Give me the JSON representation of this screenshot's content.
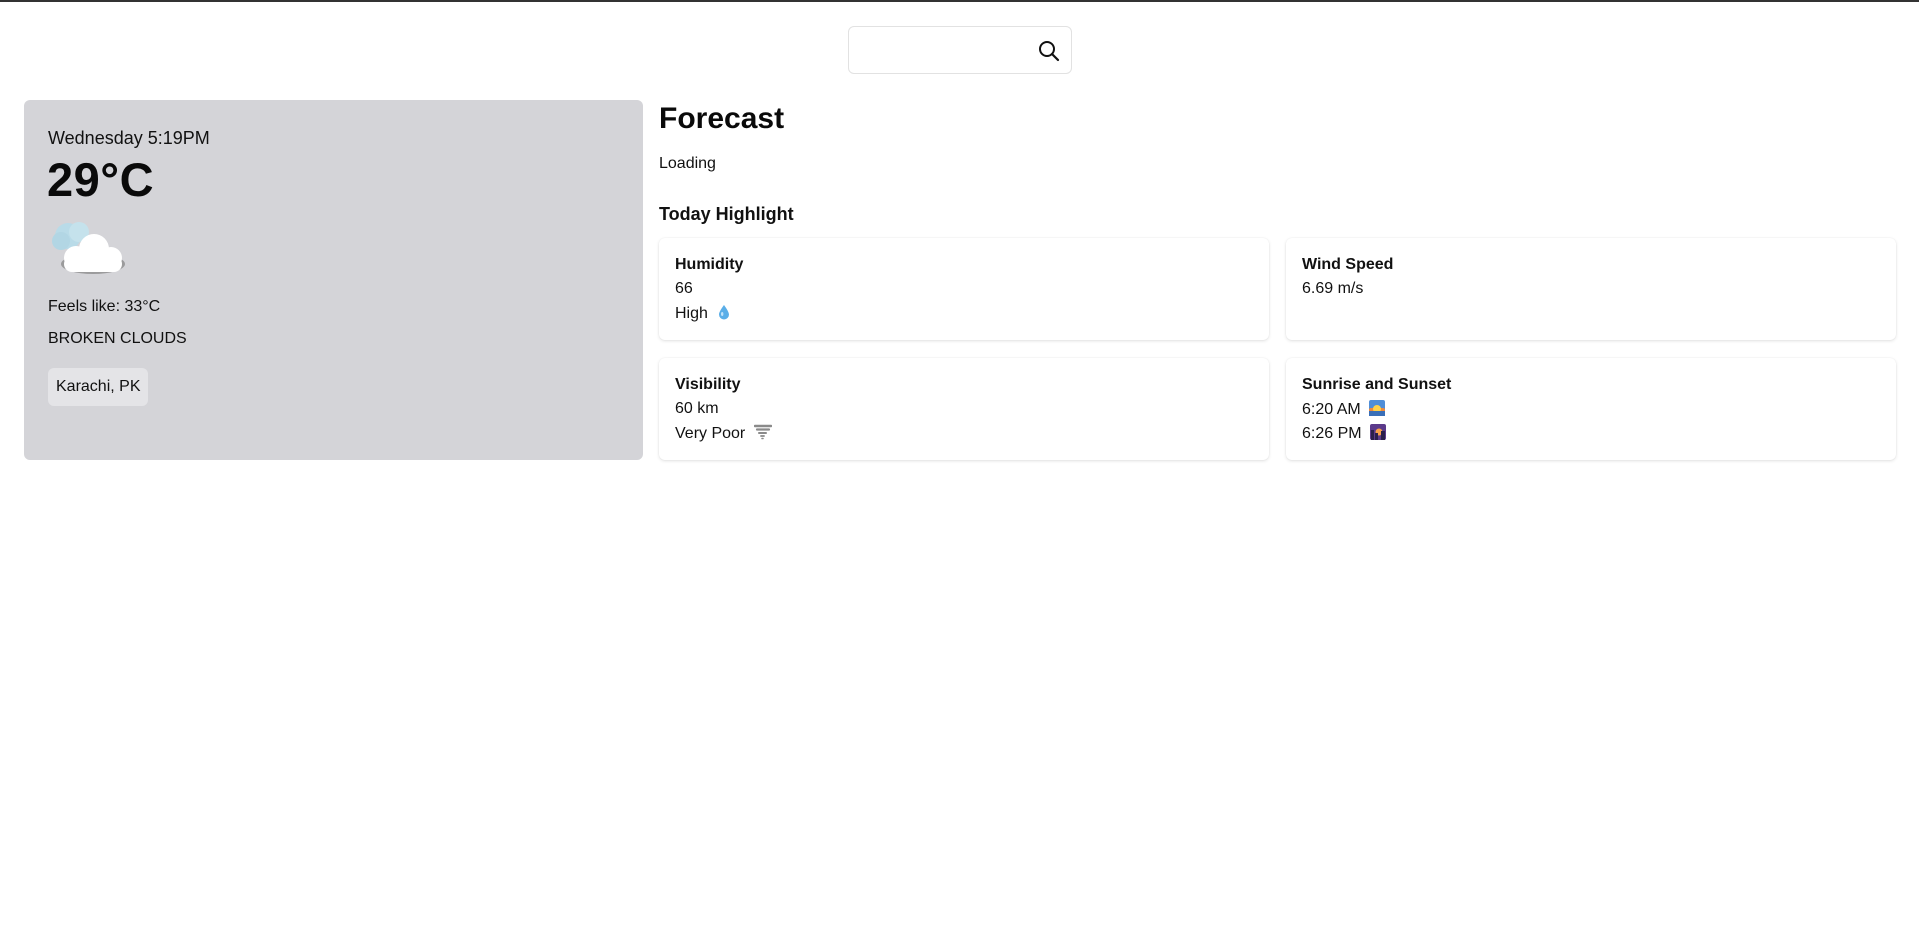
{
  "search": {
    "placeholder": "",
    "value": "",
    "icon": "search-icon"
  },
  "current": {
    "day_time": "Wednesday 5:19PM",
    "temperature": "29°C",
    "icon": "broken-clouds-icon",
    "feels_like": "Feels like: 33°C",
    "description": "BROKEN CLOUDS",
    "location": "Karachi, PK"
  },
  "forecast": {
    "title": "Forecast",
    "status": "Loading"
  },
  "highlights": {
    "title": "Today Highlight",
    "humidity": {
      "label": "Humidity",
      "value": "66",
      "level": "High",
      "icon": "water-drop-icon"
    },
    "wind": {
      "label": "Wind Speed",
      "value": "6.69 m/s"
    },
    "visibility": {
      "label": "Visibility",
      "value": "60 km",
      "level": "Very Poor",
      "icon": "tornado-icon"
    },
    "sun": {
      "label": "Sunrise and Sunset",
      "sunrise": "6:20 AM",
      "sunset": "6:26 PM",
      "sunrise_icon": "sunrise-icon",
      "sunset_icon": "sunset-icon"
    }
  },
  "colors": {
    "left_card_bg": "#d4d4d8",
    "location_chip_bg": "#e4e4e7"
  }
}
